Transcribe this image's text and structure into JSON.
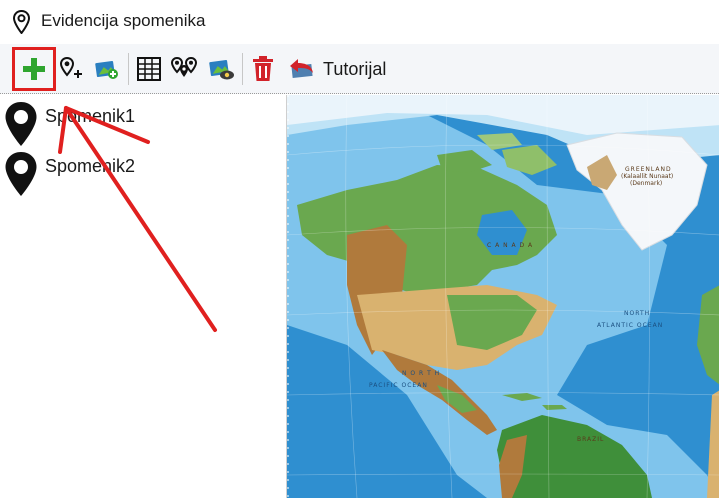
{
  "window": {
    "title": "Evidencija spomenika",
    "title_icon": "map-pin-icon"
  },
  "toolbar": {
    "buttons": [
      {
        "name": "add-monument-button",
        "icon": "plus-icon",
        "color": "#2fa52f"
      },
      {
        "name": "add-location-button",
        "icon": "pin-plus-icon"
      },
      {
        "name": "add-image-button",
        "icon": "image-plus-icon"
      },
      {
        "name": "table-view-button",
        "icon": "table-icon"
      },
      {
        "name": "show-pins-button",
        "icon": "multi-pin-icon"
      },
      {
        "name": "view-image-button",
        "icon": "image-eye-icon"
      },
      {
        "name": "delete-button",
        "icon": "trash-icon",
        "color": "#d2232a"
      },
      {
        "name": "tutorial-button",
        "icon": "undo-arrow-icon",
        "color": "#d2232a"
      }
    ],
    "tutorial_label": "Tutorijal"
  },
  "list": {
    "items": [
      {
        "label": "Spomenik1",
        "icon": "map-pin-icon"
      },
      {
        "label": "Spomenik2",
        "icon": "map-pin-icon"
      }
    ]
  },
  "map": {
    "labels": {
      "canada": "C A N A D A",
      "north_pacific": "N O R T H",
      "pacific_ocean": "PACIFIC OCEAN",
      "atlantic": "ATLANTIC OCEAN",
      "north_atlantic": "NORTH",
      "greenland": "GREENLAND",
      "greenland_sub": "(Kalaallit Nunaat)",
      "greenland_sub2": "(Denmark)",
      "brazil": "BRAZIL"
    },
    "colors": {
      "ocean": "#2f8fd0",
      "shelf": "#7fc4ec",
      "ice": "#f4f7fa",
      "land_green": "#6aa84f",
      "land_tan": "#d9b26f",
      "land_brown": "#b07a3c"
    }
  },
  "annotations": {
    "highlight_color": "#e0201f"
  }
}
